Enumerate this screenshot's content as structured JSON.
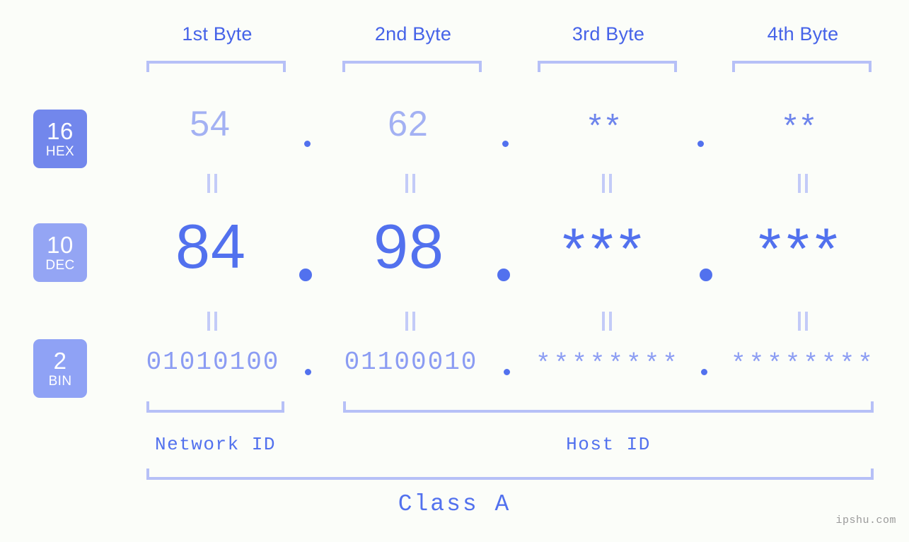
{
  "page": {
    "background_color": "#fbfdf9",
    "accent_strong": "#5271ee",
    "accent_mid": "#7287ec",
    "accent_light": "#b6c0f7",
    "watermark": "ipshu.com"
  },
  "byte_headers": [
    {
      "label": "1st Byte"
    },
    {
      "label": "2nd Byte"
    },
    {
      "label": "3rd Byte"
    },
    {
      "label": "4th Byte"
    }
  ],
  "radix_rows": [
    {
      "badge_number": "16",
      "badge_abbr": "HEX",
      "badge_color": "#7287ec",
      "values": [
        "54",
        "62",
        "**",
        "**"
      ],
      "separator": "."
    },
    {
      "badge_number": "10",
      "badge_abbr": "DEC",
      "badge_color": "#94a5f4",
      "values": [
        "84",
        "98",
        "***",
        "***"
      ],
      "separator": "."
    },
    {
      "badge_number": "2",
      "badge_abbr": "BIN",
      "badge_color": "#8fa2f5",
      "values": [
        "01010100",
        "01100010",
        "********",
        "********"
      ],
      "separator": "."
    }
  ],
  "equality_symbol": "=",
  "sections": [
    {
      "label": "Network ID"
    },
    {
      "label": "Host ID"
    }
  ],
  "class": {
    "label": "Class A"
  }
}
